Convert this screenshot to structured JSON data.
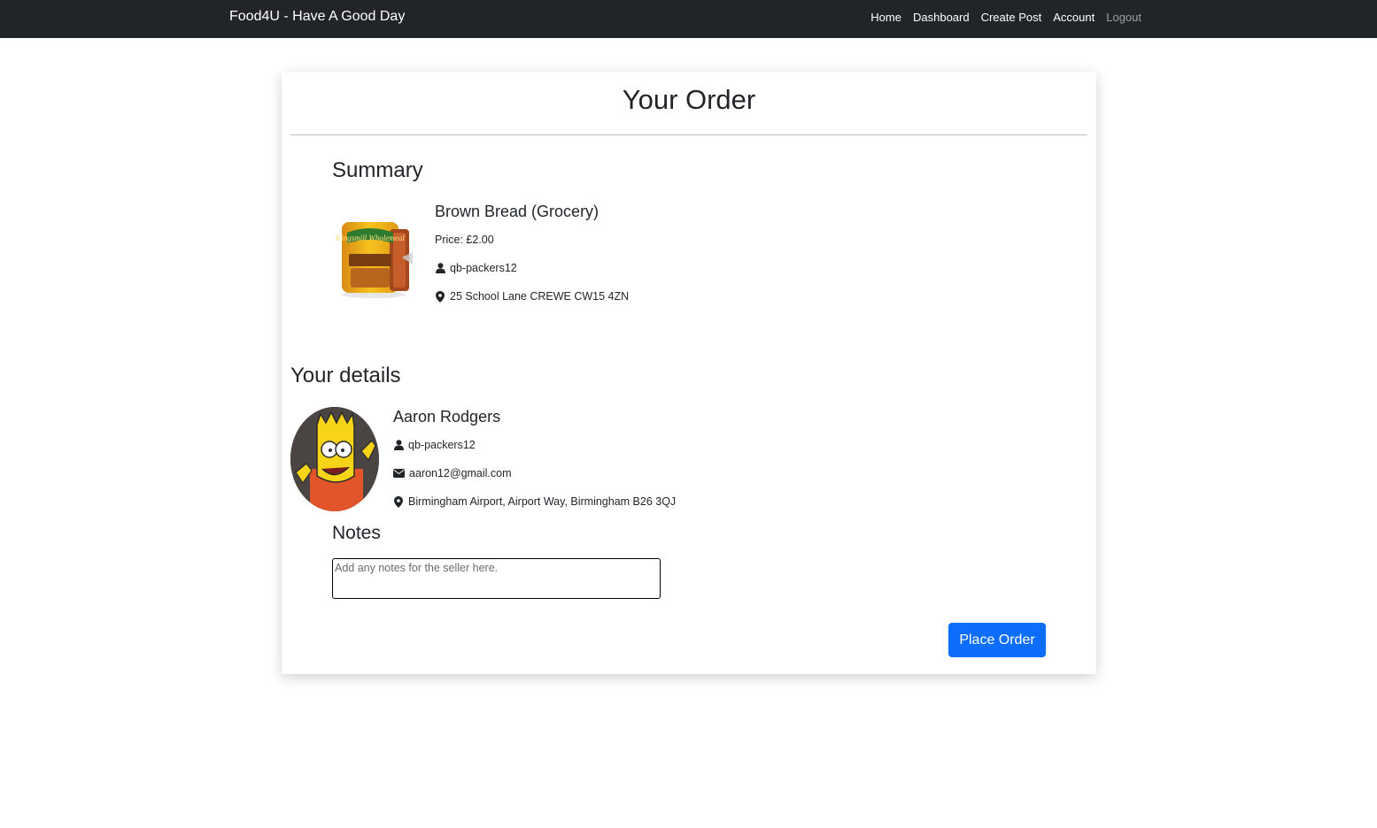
{
  "navbar": {
    "brand": "Food4U - Have A Good Day",
    "links": [
      "Home",
      "Dashboard",
      "Create Post",
      "Account"
    ],
    "logout": "Logout",
    "background": "#212529"
  },
  "page": {
    "title": "Your Order"
  },
  "summary": {
    "heading": "Summary",
    "item_title": "Brown Bread (Grocery)",
    "price": "Price: £2.00",
    "seller": "qb-packers12",
    "address": "25 School Lane CREWE CW15 4ZN",
    "image_label": "Kingsmill Wholemeal"
  },
  "details": {
    "heading": "Your details",
    "name": "Aaron Rodgers",
    "username": "qb-packers12",
    "email": "aaron12@gmail.com",
    "address": "Birmingham Airport, Airport Way, Birmingham B26 3QJ"
  },
  "notes": {
    "heading": "Notes",
    "placeholder": "Add any notes for the seller here."
  },
  "actions": {
    "place_order": "Place Order",
    "accent": "#0d6efd"
  }
}
